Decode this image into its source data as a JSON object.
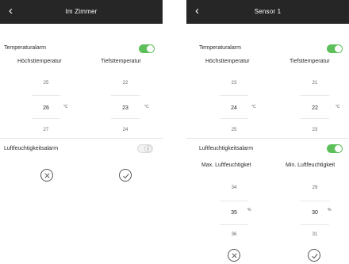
{
  "back_glyph": "‹",
  "unit_symbol": "°C",
  "humidity_unit_symbol": "%",
  "panel1": {
    "title": "Im Zimmer",
    "temp_alarm_label": "Temperaturalarm",
    "temp_alarm_on": true,
    "max_temp_label": "Höchsttemperatur",
    "min_temp_label": "Tiefsttemperatur",
    "max_temp": {
      "prev": "25",
      "value": "26",
      "next": "27"
    },
    "min_temp": {
      "prev": "22",
      "value": "23",
      "next": "24"
    },
    "humidity_alarm_label": "Luftfeuchtigkeitsalarm",
    "humidity_alarm_on": false
  },
  "panel2": {
    "title": "Sensor 1",
    "temp_alarm_label": "Temperaturalarm",
    "temp_alarm_on": true,
    "max_temp_label": "Höchsttemperatur",
    "min_temp_label": "Tiefsttemperatur",
    "max_temp": {
      "prev": "23",
      "value": "24",
      "next": "25"
    },
    "min_temp": {
      "prev": "21",
      "value": "22",
      "next": "23"
    },
    "humidity_alarm_label": "Luftfeuchtigkeitsalarm",
    "humidity_alarm_on": true,
    "max_humidity_label": "Max. Luftfeuchtigket",
    "min_humidity_label": "Min. Luftfeuchtigkeit",
    "max_humidity": {
      "prev": "34",
      "value": "35",
      "next": "36"
    },
    "min_humidity": {
      "prev": "29",
      "value": "30",
      "next": "31"
    }
  },
  "colors": {
    "header": "#262626",
    "toggle_on": "#5cbf5a",
    "toggle_off": "#f1f1f1"
  },
  "icons": {
    "cancel": "cancel-icon",
    "confirm": "check-icon",
    "back": "back-arrow-icon"
  }
}
